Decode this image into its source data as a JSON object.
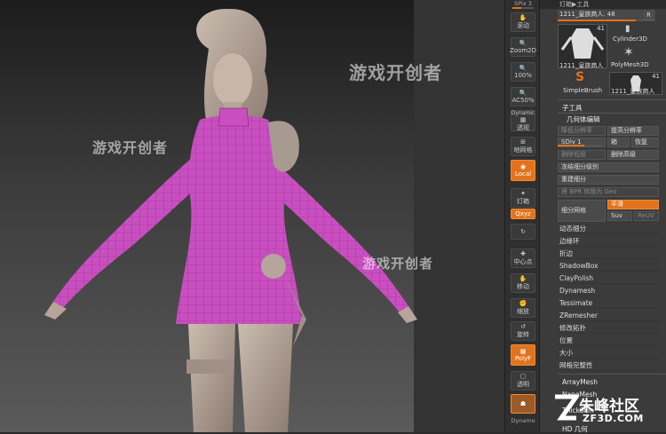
{
  "viewport": {
    "watermarks": [
      "游戏开创者",
      "游戏开创者",
      "游戏开创者"
    ]
  },
  "shelf": {
    "top_label": "SPix 3",
    "buttons": [
      {
        "label": "滚动",
        "icon": "hand-icon"
      },
      {
        "label": "Zoom2D",
        "icon": "magnifier-icon"
      },
      {
        "label": "100%",
        "icon": "magnifier-icon"
      },
      {
        "label": "AC50%",
        "icon": "magnifier-icon"
      },
      {
        "label": "Dynamic",
        "icon": "text-icon"
      },
      {
        "label": "透视",
        "icon": "perspective-icon"
      },
      {
        "label": "地网格",
        "icon": "floor-grid-icon"
      },
      {
        "label": "Local",
        "icon": "local-symmetry-icon"
      },
      {
        "label": "灯箱",
        "icon": "lightbox-icon"
      },
      {
        "label": "Qxyz",
        "icon": "axis-icon"
      },
      {
        "label": "",
        "icon": "rotate-icon"
      },
      {
        "label": "中心点",
        "icon": "center-icon"
      },
      {
        "label": "移动",
        "icon": "hand-move-icon"
      },
      {
        "label": "缩放",
        "icon": "scale-icon"
      },
      {
        "label": "旋转",
        "icon": "rotate-icon"
      },
      {
        "label": "PolyF",
        "icon": "polyframe-icon"
      },
      {
        "label": "透明",
        "icon": "transparency-icon"
      },
      {
        "label": "",
        "icon": "ghost-icon"
      },
      {
        "label": "Dynamo",
        "icon": "solo-icon"
      }
    ]
  },
  "palette": {
    "header": "灯箱▶工具",
    "current_tool": "1211_皇族商人. 48",
    "r_button": "R",
    "tools": [
      {
        "label": "1211_皇族商人",
        "count": "41"
      },
      {
        "label": "Cylinder3D",
        "count": ""
      },
      {
        "label": "PolyMesh3D",
        "count": ""
      },
      {
        "label": "SimpleBrush",
        "count": ""
      },
      {
        "label": "1211_皇族商人",
        "count": "41"
      }
    ],
    "subtool_title": "子工具",
    "geometry_title": "几何体编辑",
    "lower_res": "降低分辨率",
    "higher_res": "提高分辨率",
    "cage": "箱",
    "rstr": "恢复",
    "sdiv": "SDiv 1",
    "del_lower": "删除低级",
    "del_higher": "删除高级",
    "freeze": "冻结细分级别",
    "reconstruct": "重建细分",
    "convert_bpr": "将 BPR 转换为 Geo",
    "divide": "细分网格",
    "smooth": "平滑",
    "suv": "Suv",
    "reuv": "ReUV",
    "items": [
      "动态细分",
      "边缘环",
      "折边",
      "ShadowBox",
      "ClayPolish",
      "Dynamesh",
      "Tessimate",
      "ZRemesher",
      "修改拓扑",
      "位置",
      "大小",
      "网格完整性"
    ],
    "array_mesh": "ArrayMesh",
    "nano_mesh": "NanoMesh",
    "thick_skin": "ThickSkin",
    "hd_geometry": "HD 几何"
  },
  "logo": {
    "main": "朱峰社区",
    "sub": "ZF3D.COM"
  },
  "colors": {
    "accent": "#e2731c",
    "dress": "#c94fc0",
    "skin": "#b9a79b"
  }
}
